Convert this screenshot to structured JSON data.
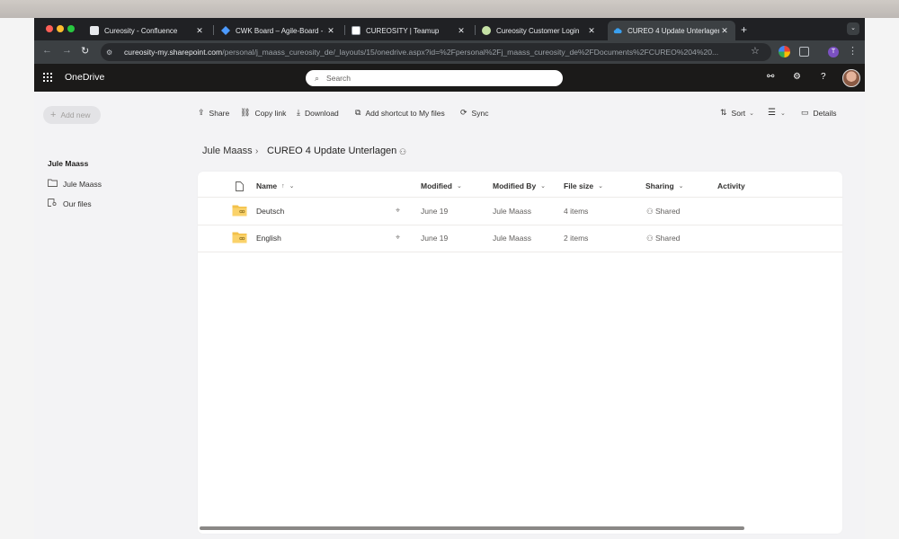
{
  "browser": {
    "tabs": [
      {
        "title": "Cureosity - Confluence",
        "favicon": "confluence-page-icon"
      },
      {
        "title": "CWK Board – Agile-Board - Jira",
        "favicon": "jira-icon"
      },
      {
        "title": "CUREOSITY | Teamup",
        "favicon": "calendar-icon"
      },
      {
        "title": "Cureosity Customer Login",
        "favicon": "cureosity-logo-icon"
      },
      {
        "title": "CUREO 4 Update Unterlagen",
        "favicon": "onedrive-cloud-icon",
        "active": true
      }
    ],
    "url_host": "cureosity-my.sharepoint.com",
    "url_path": "/personal/j_maass_cureosity_de/_layouts/15/onedrive.aspx?id=%2Fpersonal%2Fj_maass_cureosity_de%2FDocuments%2FCUREO%204%20...",
    "profile_initial": "T"
  },
  "app": {
    "name": "OneDrive",
    "search_placeholder": "Search"
  },
  "leftnav": {
    "add_new": "Add new",
    "owner": "Jule Maass",
    "items": [
      {
        "label": "Jule Maass",
        "icon": "folder-icon"
      },
      {
        "label": "Our files",
        "icon": "shared-files-icon"
      }
    ]
  },
  "commandbar": {
    "share": "Share",
    "copy_link": "Copy link",
    "download": "Download",
    "add_shortcut": "Add shortcut to My files",
    "sync": "Sync",
    "sort": "Sort",
    "details": "Details"
  },
  "breadcrumb": {
    "root": "Jule Maass",
    "current": "CUREO 4 Update Unterlagen"
  },
  "table": {
    "columns": {
      "name": "Name",
      "modified": "Modified",
      "modified_by": "Modified By",
      "file_size": "File size",
      "sharing": "Sharing",
      "activity": "Activity"
    },
    "rows": [
      {
        "name": "Deutsch",
        "modified": "June 19",
        "modified_by": "Jule Maass",
        "file_size": "4 items",
        "sharing": "Shared"
      },
      {
        "name": "English",
        "modified": "June 19",
        "modified_by": "Jule Maass",
        "file_size": "2 items",
        "sharing": "Shared"
      }
    ]
  },
  "colors": {
    "folder": "#f3c14b",
    "header_bg": "#1b1a19",
    "tabstrip_bg": "#202124"
  }
}
